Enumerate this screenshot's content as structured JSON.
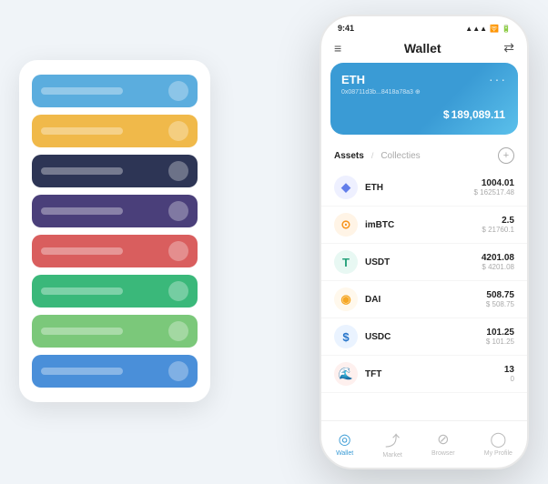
{
  "scene": {
    "background": "#f0f4f8"
  },
  "card_stack": {
    "cards": [
      {
        "id": "card-1",
        "color": "#5badde",
        "label": "",
        "has_icon": true
      },
      {
        "id": "card-2",
        "color": "#f0b94a",
        "label": "",
        "has_icon": true
      },
      {
        "id": "card-3",
        "color": "#2d3555",
        "label": "",
        "has_icon": true
      },
      {
        "id": "card-4",
        "color": "#4a3f7a",
        "label": "",
        "has_icon": true
      },
      {
        "id": "card-5",
        "color": "#d95e5e",
        "label": "",
        "has_icon": true
      },
      {
        "id": "card-6",
        "color": "#3ab87a",
        "label": "",
        "has_icon": true
      },
      {
        "id": "card-7",
        "color": "#7bc87a",
        "label": "",
        "has_icon": true
      },
      {
        "id": "card-8",
        "color": "#4a8fd9",
        "label": "",
        "has_icon": true
      }
    ]
  },
  "phone": {
    "status_bar": {
      "time": "9:41",
      "signal": "●●●",
      "wifi": "▲",
      "battery": "■"
    },
    "header": {
      "menu_icon": "≡",
      "title": "Wallet",
      "scan_icon": "⇄"
    },
    "eth_card": {
      "name": "ETH",
      "dots": "···",
      "address": "0x08711d3b...8418a78a3  ⊕",
      "currency_symbol": "$",
      "balance": "189,089.11"
    },
    "assets": {
      "tab_active": "Assets",
      "tab_divider": "/",
      "tab_inactive": "Collecties",
      "add_icon": "+"
    },
    "asset_list": [
      {
        "symbol": "ETH",
        "icon_char": "◆",
        "icon_color": "#627eea",
        "icon_bg": "#eef0ff",
        "amount": "1004.01",
        "usd": "$ 162517.48"
      },
      {
        "symbol": "imBTC",
        "icon_char": "⊙",
        "icon_color": "#f7931a",
        "icon_bg": "#fff4e6",
        "amount": "2.5",
        "usd": "$ 21760.1"
      },
      {
        "symbol": "USDT",
        "icon_char": "T",
        "icon_color": "#26a17b",
        "icon_bg": "#e8f8f3",
        "amount": "4201.08",
        "usd": "$ 4201.08"
      },
      {
        "symbol": "DAI",
        "icon_char": "◉",
        "icon_color": "#f5a623",
        "icon_bg": "#fff8ec",
        "amount": "508.75",
        "usd": "$ 508.75"
      },
      {
        "symbol": "USDC",
        "icon_char": "$",
        "icon_color": "#2775ca",
        "icon_bg": "#eaf3ff",
        "amount": "101.25",
        "usd": "$ 101.25"
      },
      {
        "symbol": "TFT",
        "icon_char": "🌊",
        "icon_color": "#e8634a",
        "icon_bg": "#fef0ee",
        "amount": "13",
        "usd": "0"
      }
    ],
    "bottom_nav": [
      {
        "id": "wallet",
        "icon": "◎",
        "label": "Wallet",
        "active": true
      },
      {
        "id": "market",
        "icon": "⤴",
        "label": "Market",
        "active": false
      },
      {
        "id": "browser",
        "icon": "⊘",
        "label": "Browser",
        "active": false
      },
      {
        "id": "profile",
        "icon": "◯",
        "label": "My Profile",
        "active": false
      }
    ]
  }
}
